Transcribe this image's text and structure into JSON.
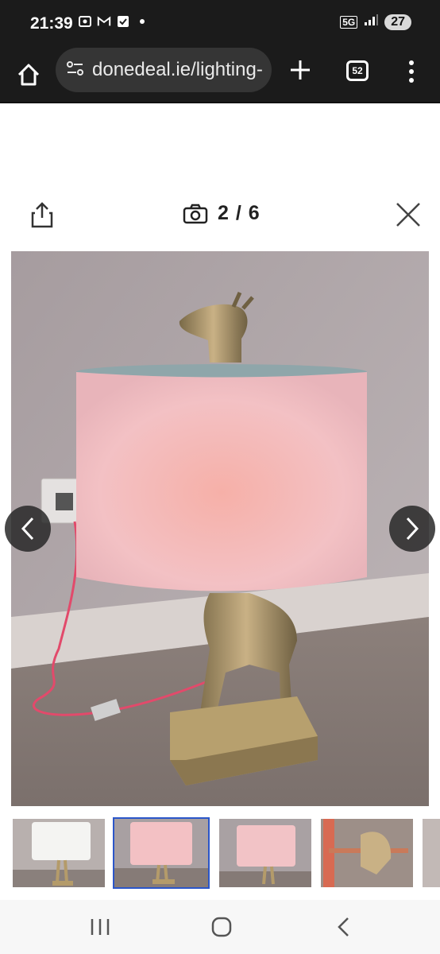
{
  "status": {
    "time": "21:39",
    "network": "5G",
    "battery": "27",
    "left_icons": [
      "screen-record-icon",
      "gmail-icon",
      "checkbox-icon",
      "dot-icon"
    ]
  },
  "browser": {
    "url": "donedeal.ie/lighting-",
    "tab_count": "52"
  },
  "viewer": {
    "counter": "2 / 6"
  },
  "gallery": {
    "thumbnails": [
      "thumb-1",
      "thumb-2",
      "thumb-3",
      "thumb-4"
    ],
    "active_index": 1
  },
  "colors": {
    "status_bg": "#1b1b1b",
    "url_pill": "#353535",
    "active_thumb_border": "#2b56c9"
  }
}
